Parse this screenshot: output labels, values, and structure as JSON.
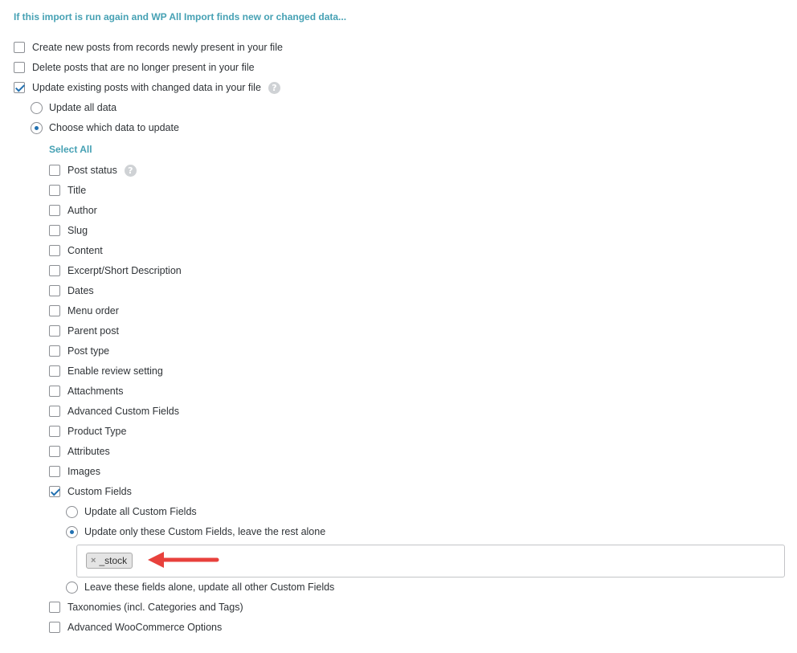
{
  "heading": "If this import is run again and WP All Import finds new or changed data...",
  "top_options": [
    {
      "label": "Create new posts from records newly present in your file",
      "checked": false
    },
    {
      "label": "Delete posts that are no longer present in your file",
      "checked": false
    },
    {
      "label": "Update existing posts with changed data in your file",
      "checked": true
    }
  ],
  "update_mode": [
    {
      "label": "Update all data",
      "selected": false
    },
    {
      "label": "Choose which data to update",
      "selected": true
    }
  ],
  "select_all": "Select All",
  "fields": [
    {
      "label": "Post status",
      "checked": false
    },
    {
      "label": "Title",
      "checked": false
    },
    {
      "label": "Author",
      "checked": false
    },
    {
      "label": "Slug",
      "checked": false
    },
    {
      "label": "Content",
      "checked": false
    },
    {
      "label": "Excerpt/Short Description",
      "checked": false
    },
    {
      "label": "Dates",
      "checked": false
    },
    {
      "label": "Menu order",
      "checked": false
    },
    {
      "label": "Parent post",
      "checked": false
    },
    {
      "label": "Post type",
      "checked": false
    },
    {
      "label": "Enable review setting",
      "checked": false
    },
    {
      "label": "Attachments",
      "checked": false
    },
    {
      "label": "Advanced Custom Fields",
      "checked": false
    },
    {
      "label": "Product Type",
      "checked": false
    },
    {
      "label": "Attributes",
      "checked": false
    },
    {
      "label": "Images",
      "checked": false
    },
    {
      "label": "Custom Fields",
      "checked": true
    }
  ],
  "custom_fields_mode": [
    {
      "label": "Update all Custom Fields",
      "selected": false
    },
    {
      "label": "Update only these Custom Fields, leave the rest alone",
      "selected": true
    },
    {
      "label": "Leave these fields alone, update all other Custom Fields",
      "selected": false
    }
  ],
  "custom_field_tags": [
    {
      "remove": "×",
      "label": "_stock"
    }
  ],
  "more_fields": [
    {
      "label": "Taxonomies (incl. Categories and Tags)",
      "checked": false
    },
    {
      "label": "Advanced WooCommerce Options",
      "checked": false
    }
  ],
  "help_icon_glyph": "?",
  "colors": {
    "accent": "#46a1b4",
    "check": "#2271b1",
    "arrow": "#e8413c"
  }
}
